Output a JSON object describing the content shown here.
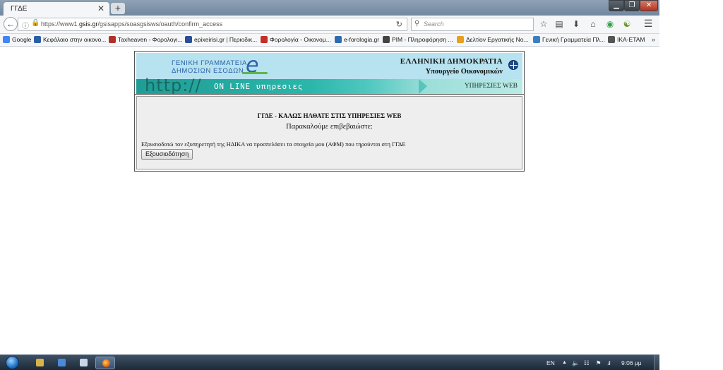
{
  "browser": {
    "tab_title": "ΓΓΔΕ",
    "tab_close": "✕",
    "new_tab": "+",
    "window_buttons": {
      "minimize": "▁",
      "maximize": "❐",
      "close": "✕"
    },
    "url_prefix": "https://www1.",
    "url_domain": "gsis.gr",
    "url_path": "/gsisapps/soasgsisws/oauth/confirm_access",
    "search_placeholder": "Search",
    "icons": {
      "back": "back-arrow-icon",
      "info": "info-icon",
      "lock": "lock-icon",
      "reload": "reload-icon",
      "search": "search-icon",
      "bookmark_star": "star-icon",
      "reading_list": "clipboard-icon",
      "downloads": "download-icon",
      "home": "home-icon",
      "sync": "sync-icon",
      "addon": "addon-icon",
      "menu": "hamburger-menu-icon"
    }
  },
  "bookmarks": [
    {
      "label": "Google",
      "color": "#4285f4"
    },
    {
      "label": "Κεφάλαιο στην οικονο...",
      "color": "#2a5ea8"
    },
    {
      "label": "Taxheaven - Φορολογι...",
      "color": "#b0312a"
    },
    {
      "label": "epixeirisi.gr | Περιοδικ...",
      "color": "#2b4e9a"
    },
    {
      "label": "Φορολογία - Οικονομ...",
      "color": "#c2302a"
    },
    {
      "label": "e-forologia.gr",
      "color": "#2f6bb0"
    },
    {
      "label": "PIM - Πληροφόρηση ...",
      "color": "#444444"
    },
    {
      "label": "Δελτίον Εργατικής Νο...",
      "color": "#e5a020"
    },
    {
      "label": "Γενική Γραμματεία Πλ...",
      "color": "#3a7fc0"
    },
    {
      "label": "IKA-ETAM",
      "color": "#555555"
    }
  ],
  "bookmarks_more": "»",
  "banner": {
    "logo_line1": "ΓΕΝΙΚΗ ΓΡΑΜΜΑΤΕΙΑ",
    "logo_line2": "ΔΗΜΟΣΙΩΝ ΕΣΟΔΩΝ",
    "logo_letter": "e",
    "republic": "ΕΛΛΗΝΙΚΗ ΔΗΜΟΚΡΑΤΙΑ",
    "ministry": "Υπουργείο Οικονομικών",
    "http_text": "http://",
    "online_text": "ON LINE υπηρεσιες",
    "services_web": "ΥΠΗΡΕΣΙΕΣ WEB"
  },
  "content": {
    "welcome": "ΓΓΔΕ - ΚΑΛΩΣ ΗΛΘΑΤΕ ΣΤΙΣ ΥΠΗΡΕΣΙΕΣ WEB",
    "confirm_prompt": "Παρακαλούμε επιβεβαιώστε:",
    "authorization_text": "Εξουσιοδοτώ τον εξυπηρετητή της ΗΔΙΚΑ να προσπελάσει τα στοιχεία μου (ΑΦΜ) που τηρούνται στη ΓΓΔΕ",
    "authorize_button": "Εξουσιοδότηση"
  },
  "taskbar": {
    "language": "EN",
    "clock": "9:06 μμ",
    "tray_up": "▲"
  },
  "colors": {
    "banner_bg": "#b7e2ef",
    "stripe": "#2bb6aa",
    "content_bg": "#eeeeee"
  }
}
